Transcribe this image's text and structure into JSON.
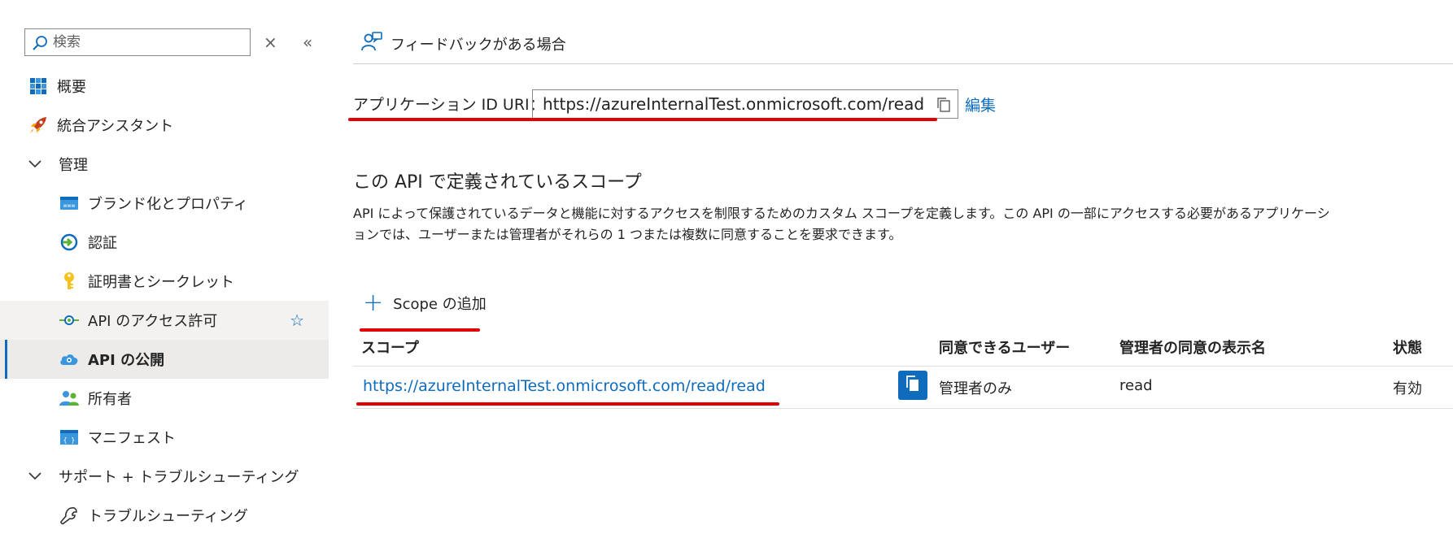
{
  "sidebar": {
    "search_placeholder": "検索",
    "close_symbol": "×",
    "collapse_symbol": "«",
    "items": [
      {
        "label": "概要",
        "icon": "overview-grid-icon"
      },
      {
        "label": "統合アシスタント",
        "icon": "rocket-icon"
      },
      {
        "label": "管理",
        "icon": "chevron-down-icon",
        "expanded": true
      },
      {
        "label": "ブランド化とプロパティ",
        "icon": "branding-icon"
      },
      {
        "label": "認証",
        "icon": "authentication-icon"
      },
      {
        "label": "証明書とシークレット",
        "icon": "key-icon"
      },
      {
        "label": "API のアクセス許可",
        "icon": "api-permissions-icon",
        "favorite_icon": "star-icon"
      },
      {
        "label": "API の公開",
        "icon": "expose-api-cloud-icon",
        "selected": true
      },
      {
        "label": "所有者",
        "icon": "owners-icon"
      },
      {
        "label": "マニフェスト",
        "icon": "manifest-icon"
      },
      {
        "label": "サポート + トラブルシューティング",
        "icon": "chevron-down-icon",
        "expanded": true
      },
      {
        "label": "トラブルシューティング",
        "icon": "wrench-icon"
      }
    ]
  },
  "main": {
    "feedback_label": "フィードバックがある場合",
    "uri_label": "アプリケーション ID URI：",
    "uri_value": "https://azureInternalTest.onmicrosoft.com/read",
    "edit_label": "編集",
    "section_title": "この API で定義されているスコープ",
    "section_desc": "API によって保護されているデータと機能に対するアクセスを制限するためのカスタム スコープを定義します。この API の一部にアクセスする必要があるアプリケーションでは、ユーザーまたは管理者がそれらの 1 つまたは複数に同意することを要求できます。",
    "add_scope_label": "Scope の追加",
    "table": {
      "headers": [
        "スコープ",
        "同意できるユーザー",
        "管理者の同意の表示名",
        "状態"
      ],
      "rows": [
        {
          "scope": "https://azureInternalTest.onmicrosoft.com/read/read",
          "consent": "管理者のみ",
          "admin_display_name": "read",
          "state": "有効"
        }
      ]
    }
  },
  "colors": {
    "accent": "#0f6cbd",
    "annotation_red": "#e00000",
    "selected_bg": "#edebe9"
  }
}
